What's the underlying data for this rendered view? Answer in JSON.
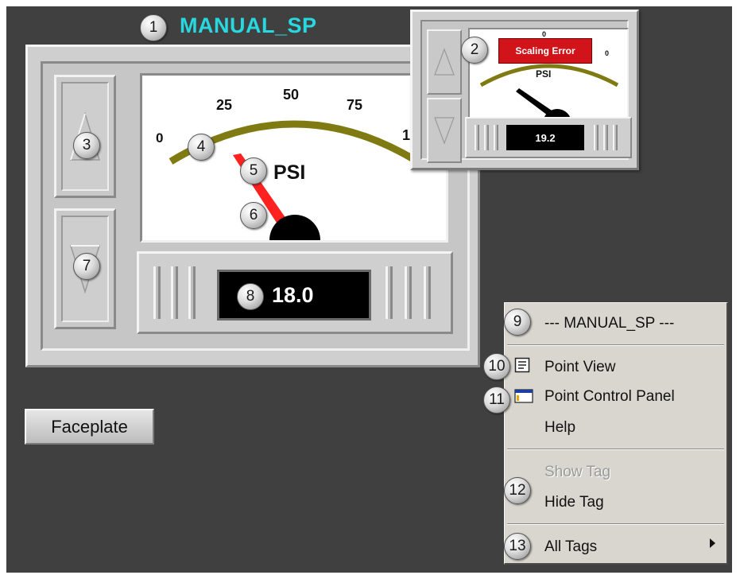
{
  "tag": {
    "title": "MANUAL_SP"
  },
  "main_gauge": {
    "scale_labels": [
      "0",
      "25",
      "50",
      "75",
      "1"
    ],
    "unit": "PSI",
    "readout": "18.0",
    "arc_color": "#807a12",
    "needle_color": "#ff2020"
  },
  "small_gauge": {
    "scale_top": "0",
    "scale_right": "0",
    "unit": "PSI",
    "error": "Scaling Error",
    "readout": "19.2",
    "error_color": "#d0141a"
  },
  "faceplate_button": {
    "label": "Faceplate"
  },
  "context_menu": {
    "header": "--- MANUAL_SP ---",
    "items": [
      {
        "label": "Point View",
        "icon": "point-view-icon",
        "enabled": true
      },
      {
        "label": "Point Control Panel",
        "icon": "control-panel-icon",
        "enabled": true
      },
      {
        "label": "Help",
        "enabled": true
      },
      {
        "label": "Show Tag",
        "enabled": false
      },
      {
        "label": "Hide Tag",
        "enabled": true
      },
      {
        "label": "All Tags",
        "submenu": true,
        "enabled": true
      }
    ]
  },
  "callouts": [
    "1",
    "2",
    "3",
    "4",
    "5",
    "6",
    "7",
    "8",
    "9",
    "10",
    "11",
    "12",
    "13"
  ],
  "colors": {
    "background": "#404040",
    "title": "#27d8e0",
    "menu_bg": "#d8d6cf"
  }
}
